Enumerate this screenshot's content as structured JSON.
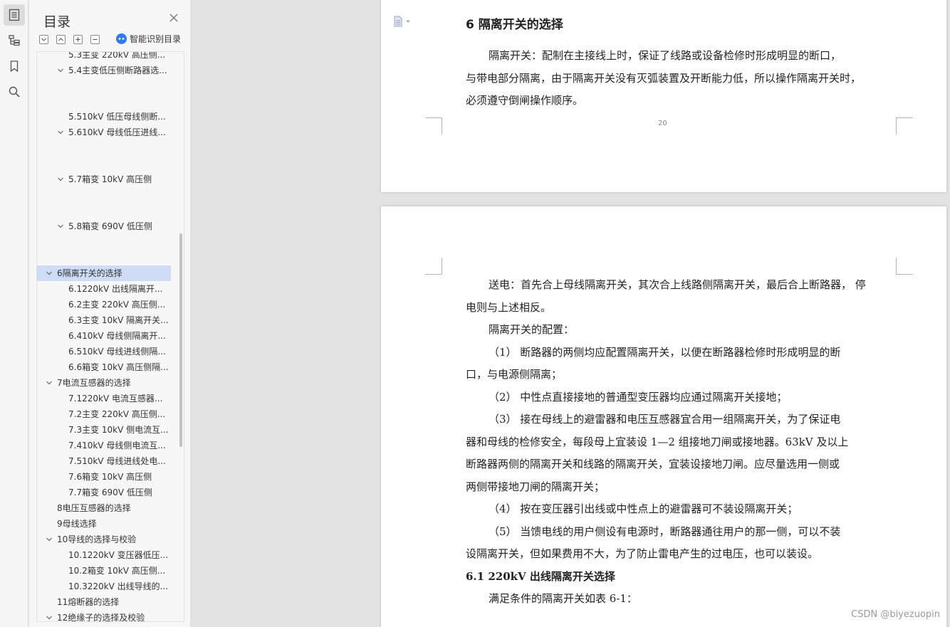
{
  "sidebar": {
    "title": "目录",
    "smart_label": "智能识别目录",
    "items": [
      {
        "label": "5.3主变 220kV 高压侧...",
        "expanded": false,
        "level": 2
      },
      {
        "label": "5.4主变低压侧断路器选...",
        "expanded": true,
        "level": 2
      },
      {
        "label": "5.510kV 低压母线侧断...",
        "expanded": false,
        "level": 2
      },
      {
        "label": "5.610kV 母线低压进线...",
        "expanded": true,
        "level": 2
      },
      {
        "label": "5.7箱变 10kV 高压侧",
        "expanded": true,
        "level": 2
      },
      {
        "label": "5.8箱变 690V 低压侧",
        "expanded": true,
        "level": 2
      },
      {
        "label": "6隔离开关的选择",
        "expanded": true,
        "level": 1,
        "selected": true
      },
      {
        "label": "6.1220kV 出线隔离开...",
        "level": 2
      },
      {
        "label": "6.2主变 220kV 高压侧...",
        "level": 2
      },
      {
        "label": "6.3主变 10kV 隔离开关...",
        "level": 2
      },
      {
        "label": "6.410kV 母线侧隔离开...",
        "level": 2
      },
      {
        "label": "6.510kV 母线进线侧隔...",
        "level": 2
      },
      {
        "label": "6.6箱变 10kV 高压侧隔...",
        "level": 2
      },
      {
        "label": "7电流互感器的选择",
        "expanded": true,
        "level": 1
      },
      {
        "label": "7.1220kV 电流互感器...",
        "level": 2
      },
      {
        "label": "7.2主变 220kV 高压侧...",
        "level": 2
      },
      {
        "label": "7.3主变 10kV 侧电流互...",
        "level": 2
      },
      {
        "label": "7.410kV 母线侧电流互...",
        "level": 2
      },
      {
        "label": "7.510kV 母线进线处电...",
        "level": 2
      },
      {
        "label": "7.6箱变 10kV 高压侧",
        "level": 2
      },
      {
        "label": "7.7箱变 690V 低压侧",
        "level": 2
      },
      {
        "label": "8电压互感器的选择",
        "level": 1
      },
      {
        "label": "9母线选择",
        "level": 1
      },
      {
        "label": "10导线的选择与校验",
        "expanded": true,
        "level": 1
      },
      {
        "label": "10.1220kV 变压器低压...",
        "level": 2
      },
      {
        "label": "10.2箱变 10kV 高压侧...",
        "level": 2
      },
      {
        "label": "10.3220kV 出线导线的...",
        "level": 2
      },
      {
        "label": "11熔断器的选择",
        "level": 1
      },
      {
        "label": "12绝缘子的选择及校验",
        "expanded": true,
        "level": 1
      }
    ]
  },
  "document": {
    "page1": {
      "heading": "6 隔离开关的选择",
      "lines": [
        "隔离开关：配制在主接线上时，保证了线路或设备检修时形成明显的断口，",
        "与带电部分隔离，由于隔离开关没有灭弧装置及开断能力低，所以操作隔离开关时，",
        "必须遵守倒闸操作顺序。"
      ],
      "page_number": "20"
    },
    "page2": {
      "lines": [
        "送电：首先合上母线隔离开关，其次合上线路侧隔离开关，最后合上断路器，  停",
        "电则与上述相反。",
        "隔离开关的配置：",
        "（1） 断路器的两侧均应配置隔离开关，以便在断路器检修时形成明显的断",
        "口，与电源侧隔离；",
        "（2） 中性点直接接地的普通型变压器均应通过隔离开关接地；",
        "（3） 接在母线上的避雷器和电压互感器宜合用一组隔离开关，为了保证电",
        "器和母线的检修安全，每段母上宜装设 1—2 组接地刀闸或接地器。63kV 及以上",
        "断路器两侧的隔离开关和线路的隔离开关，宜装设接地刀闸。应尽量选用一侧或",
        "两侧带接地刀闸的隔离开关；",
        "（4） 按在变压器引出线或中性点上的避雷器可不装设隔离开关；",
        "（5） 当馈电线的用户侧设有电源时，断路器通往用户的那一侧，可以不装",
        "设隔离开关，但如果费用不大，为了防止雷电产生的过电压，也可以装设。"
      ],
      "subheading": "6.1 220kV 出线隔离开关选择",
      "last_line": "满足条件的隔离开关如表 6-1："
    }
  },
  "watermark": "CSDN @biyezuopin"
}
